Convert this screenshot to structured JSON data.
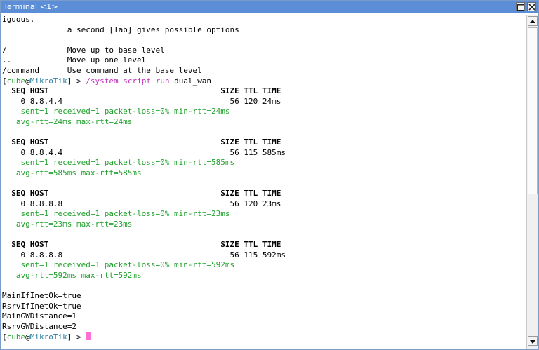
{
  "window": {
    "title": "Terminal <1>"
  },
  "terminal": {
    "help": [
      "iguous,",
      "              a second [Tab] gives possible options",
      "",
      "/             Move up to base level",
      "..            Move up one level",
      "/command      Use command at the base level"
    ],
    "prompt": {
      "user": "cube",
      "at": "@",
      "host": "MikroTik",
      "suffix": "] > "
    },
    "command": "/system script run",
    "command_arg": " dual_wan",
    "pings": [
      {
        "header": "  SEQ HOST                                     SIZE TTL TIME",
        "row": "    0 8.8.4.4                                    56 120 24ms",
        "stats1": "    sent=1 received=1 packet-loss=0% min-rtt=24ms",
        "stats2": "   avg-rtt=24ms max-rtt=24ms"
      },
      {
        "header": "  SEQ HOST                                     SIZE TTL TIME",
        "row": "    0 8.8.4.4                                    56 115 585ms",
        "stats1": "    sent=1 received=1 packet-loss=0% min-rtt=585ms",
        "stats2": "   avg-rtt=585ms max-rtt=585ms"
      },
      {
        "header": "  SEQ HOST                                     SIZE TTL TIME",
        "row": "    0 8.8.8.8                                    56 120 23ms",
        "stats1": "    sent=1 received=1 packet-loss=0% min-rtt=23ms",
        "stats2": "   avg-rtt=23ms max-rtt=23ms"
      },
      {
        "header": "  SEQ HOST                                     SIZE TTL TIME",
        "row": "    0 8.8.8.8                                    56 115 592ms",
        "stats1": "    sent=1 received=1 packet-loss=0% min-rtt=592ms",
        "stats2": "   avg-rtt=592ms max-rtt=592ms"
      }
    ],
    "result": [
      "MainIfInetOk=true",
      "RsrvIfInetOk=true",
      "MainGWDistance=1",
      "RsrvGWDistance=2"
    ]
  },
  "colors": {
    "titlebar": "#5b8ed6",
    "prompt_user": "#22a12e",
    "prompt_host": "#2a7fa0",
    "command": "#c030c0",
    "cursor": "#ff6fd8",
    "ping_stats": "#22a12e"
  },
  "icons": {
    "maximize": "maximize-icon",
    "close": "close-icon",
    "scroll_up": "arrow-up-icon",
    "scroll_down": "arrow-down-icon"
  }
}
